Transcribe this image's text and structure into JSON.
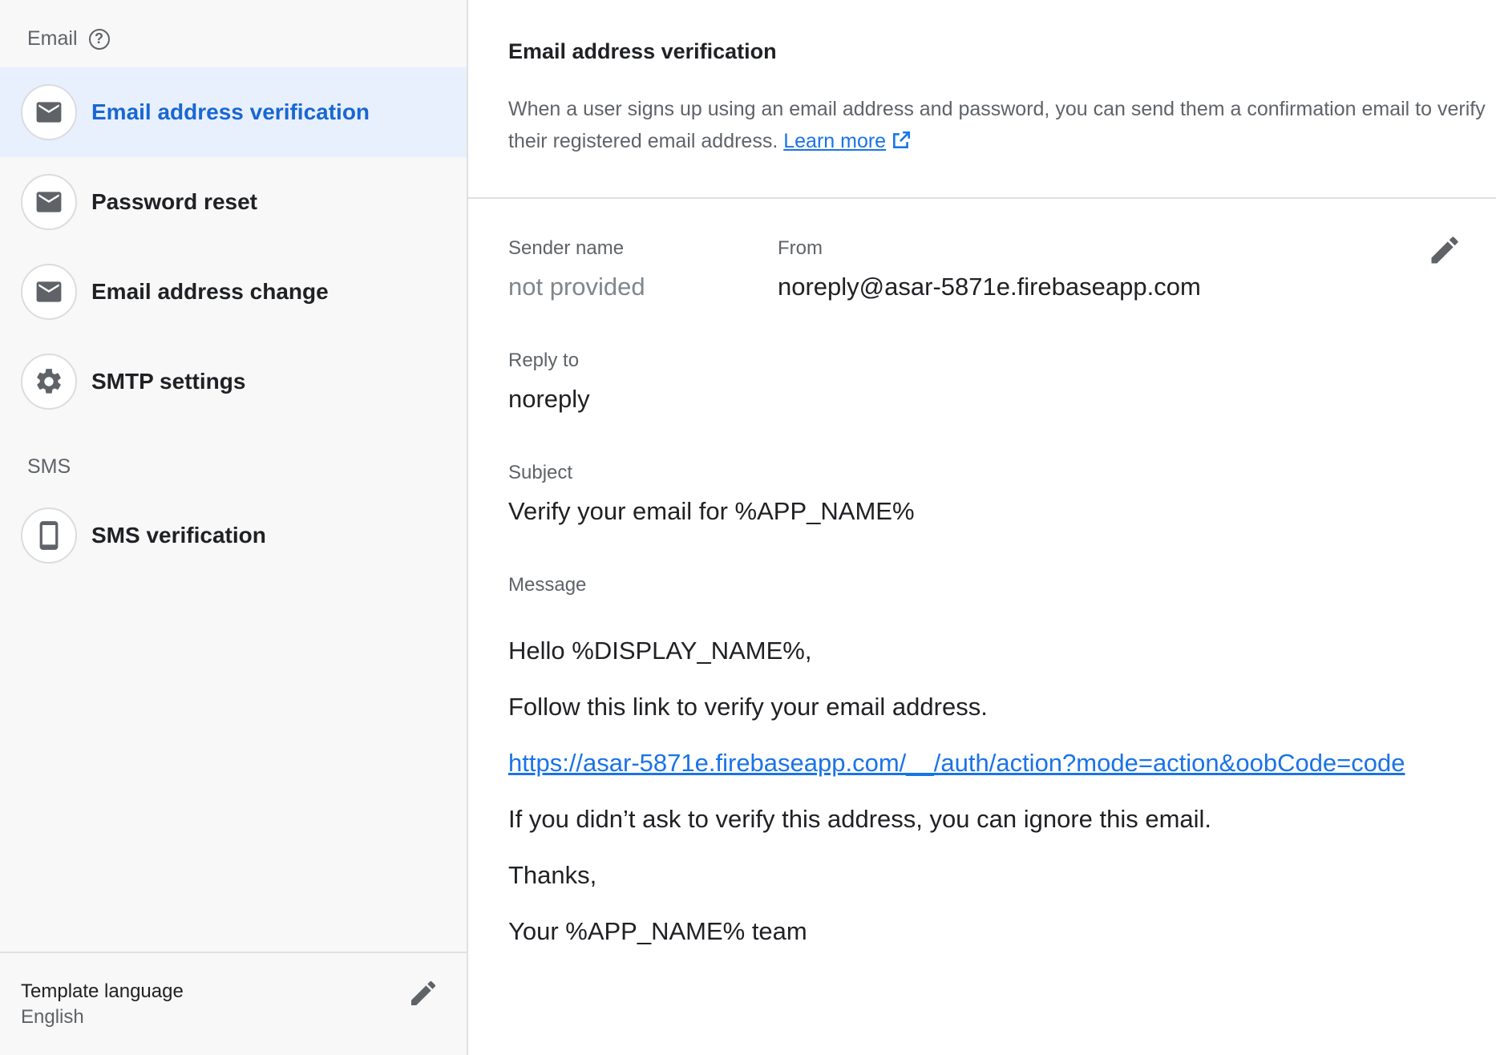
{
  "sidebar": {
    "email_header": "Email",
    "email_items": [
      {
        "label": "Email address verification",
        "icon": "mail-icon",
        "active": true
      },
      {
        "label": "Password reset",
        "icon": "mail-icon"
      },
      {
        "label": "Email address change",
        "icon": "mail-icon"
      },
      {
        "label": "SMTP settings",
        "icon": "gear-icon"
      }
    ],
    "sms_header": "SMS",
    "sms_items": [
      {
        "label": "SMS verification",
        "icon": "phone-icon"
      }
    ],
    "template_language": {
      "label": "Template language",
      "value": "English"
    }
  },
  "main": {
    "title": "Email address verification",
    "description": "When a user signs up using an email address and password, you can send them a confirmation email to verify their registered email address.",
    "learn_more": "Learn more",
    "sender_name_label": "Sender name",
    "sender_name_value": "not provided",
    "from_label": "From",
    "from_value": "noreply@asar-5871e.firebaseapp.com",
    "reply_to_label": "Reply to",
    "reply_to_value": "noreply",
    "subject_label": "Subject",
    "subject_value": "Verify your email for %APP_NAME%",
    "message_label": "Message",
    "message": {
      "greeting": "Hello %DISPLAY_NAME%,",
      "instruction": "Follow this link to verify your email address.",
      "link": "https://asar-5871e.firebaseapp.com/__/auth/action?mode=action&oobCode=code",
      "ignore": "If you didn’t ask to verify this address, you can ignore this email.",
      "thanks": "Thanks,",
      "signature": "Your %APP_NAME% team"
    }
  },
  "colors": {
    "accent": "#1967d2",
    "active_bg": "#e8f0fe",
    "sidebar_bg": "#f8f8f8",
    "link": "#1a73e8",
    "muted_text": "#5f6368"
  }
}
